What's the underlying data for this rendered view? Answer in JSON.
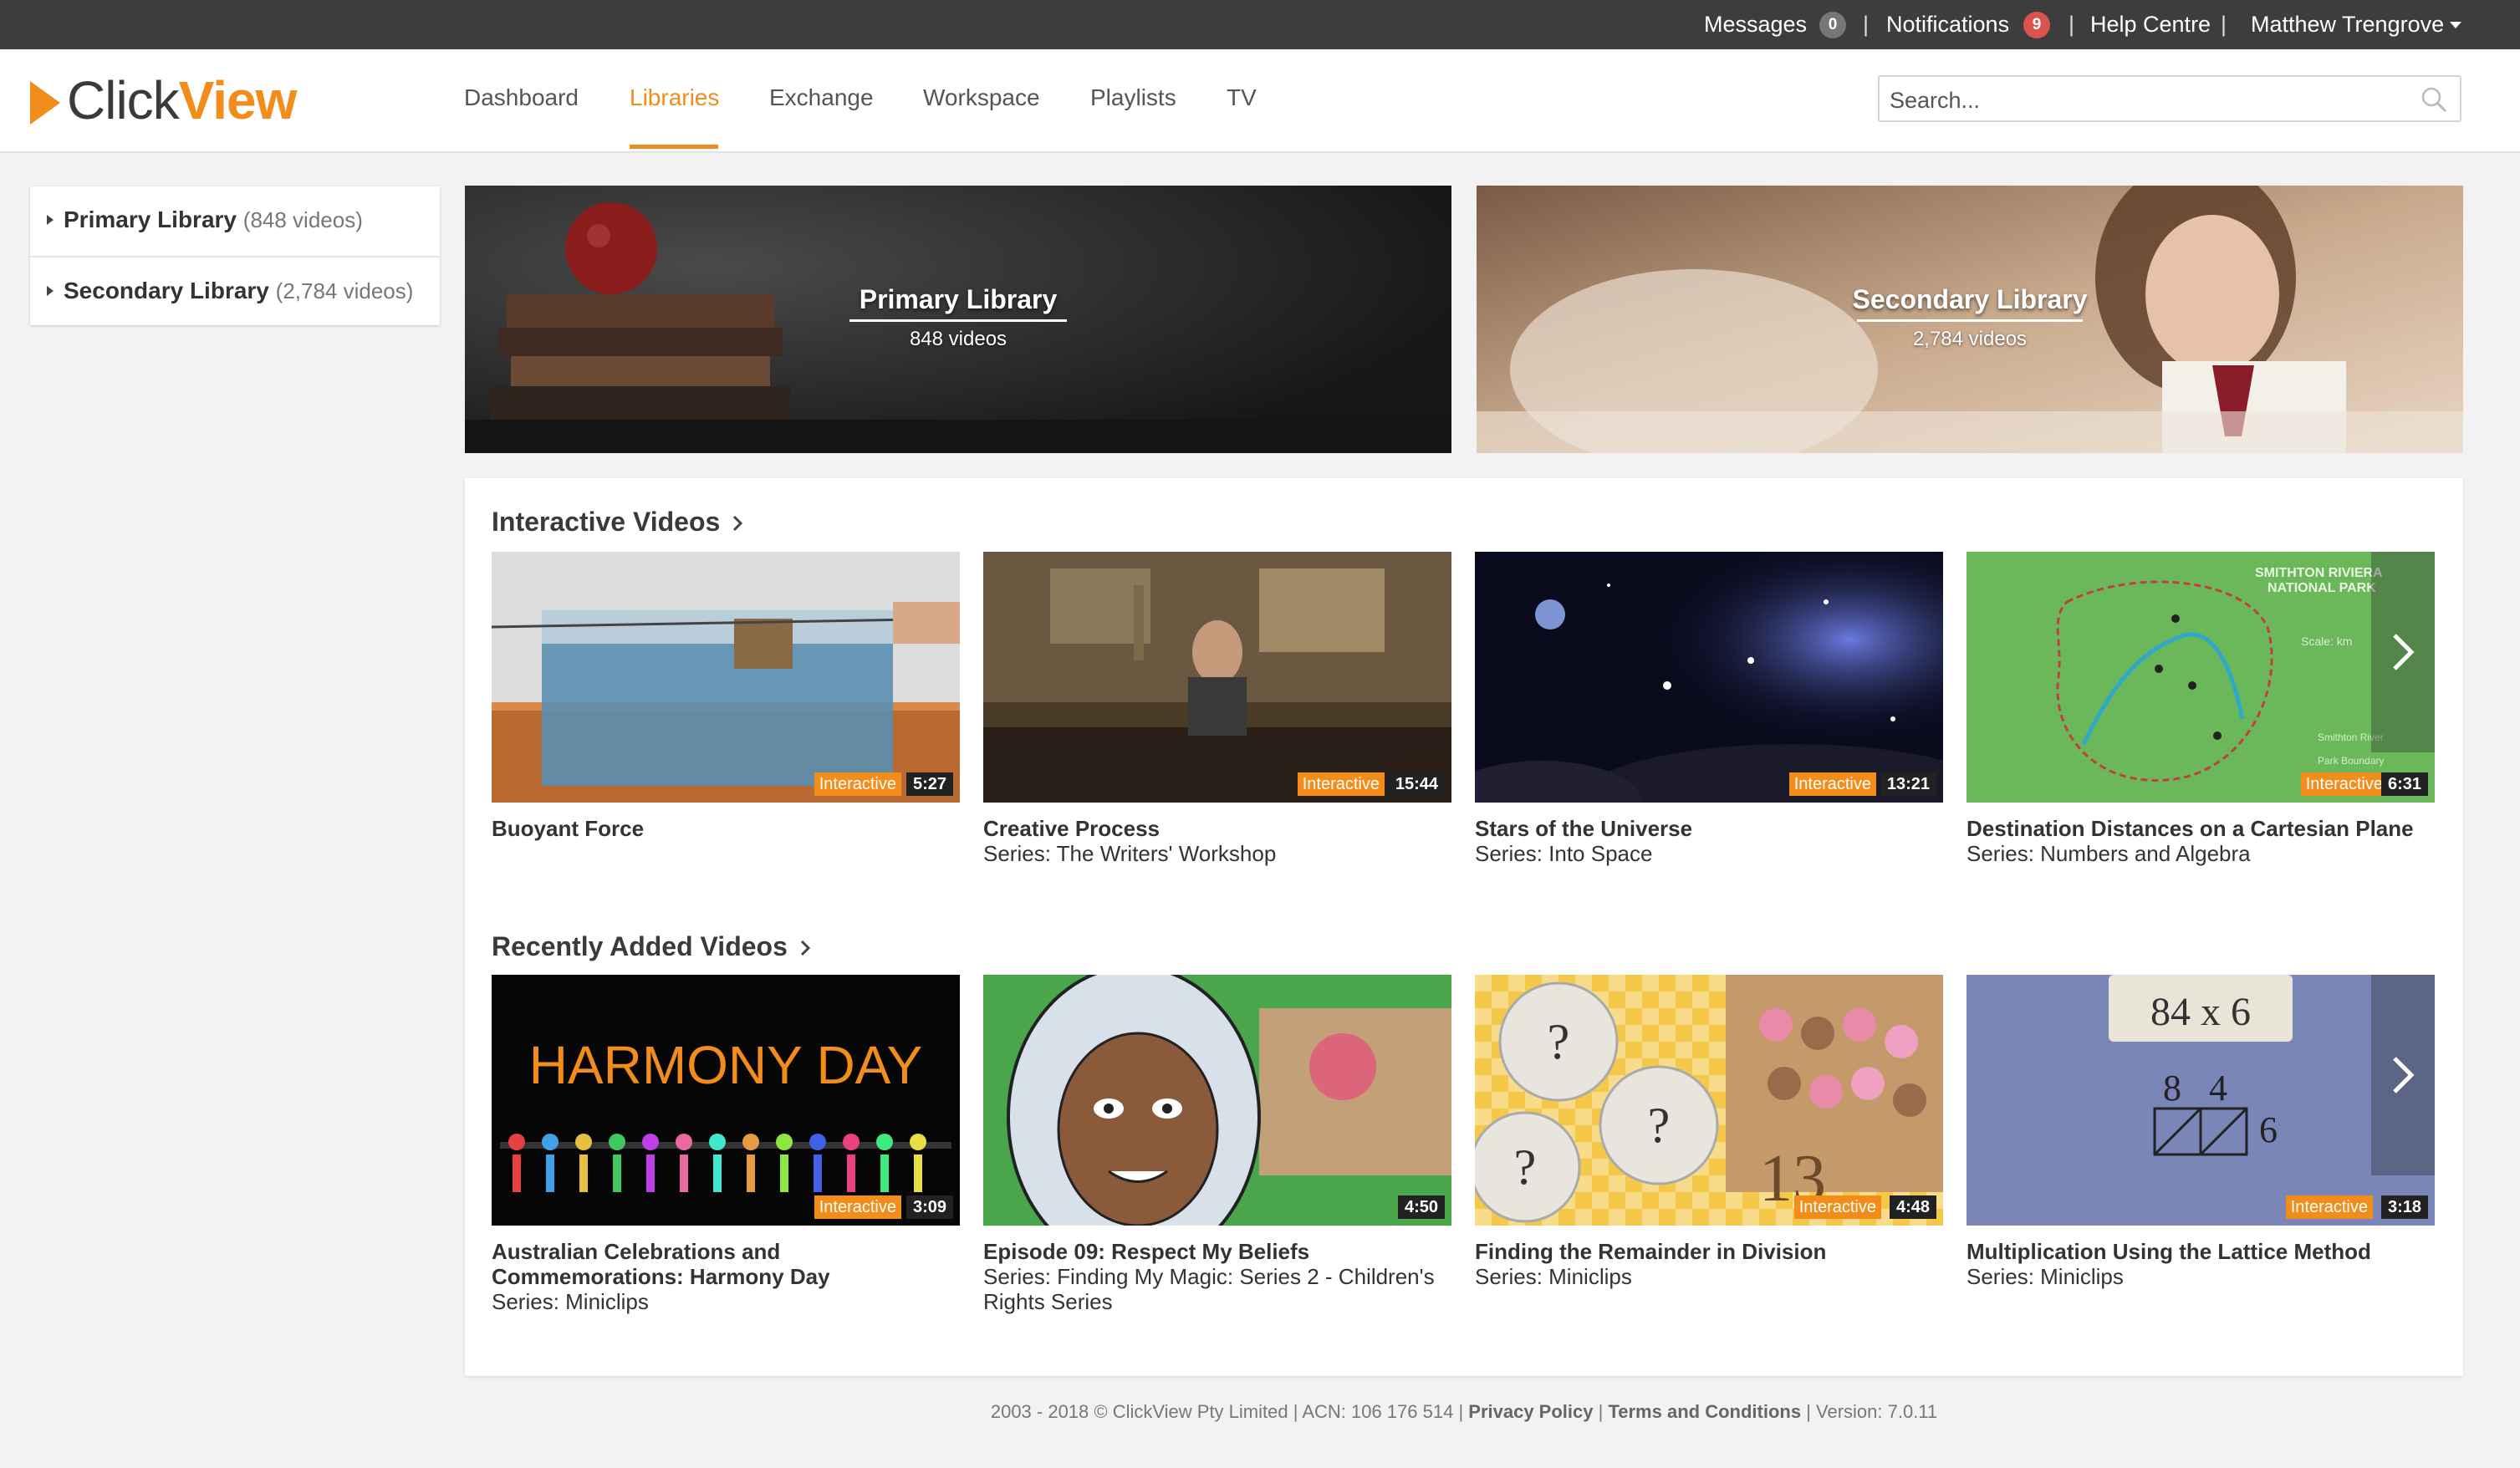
{
  "topbar": {
    "messages_label": "Messages",
    "messages_count": "0",
    "notifications_label": "Notifications",
    "notifications_count": "9",
    "help_label": "Help Centre",
    "user_name": "Matthew Trengrove",
    "separator": "|"
  },
  "header": {
    "logo_part1": "Click",
    "logo_part2": "View",
    "nav": [
      "Dashboard",
      "Libraries",
      "Exchange",
      "Workspace",
      "Playlists",
      "TV"
    ],
    "active_nav": "Libraries",
    "search_placeholder": "Search..."
  },
  "sidebar": {
    "items": [
      {
        "label": "Primary Library",
        "count": "(848 videos)"
      },
      {
        "label": "Secondary Library",
        "count": "(2,784 videos)"
      }
    ]
  },
  "banners": [
    {
      "title": "Primary Library",
      "subtitle": "848 videos"
    },
    {
      "title": "Secondary Library",
      "subtitle": "2,784 videos"
    }
  ],
  "sections": {
    "interactive": {
      "title": "Interactive Videos",
      "videos": [
        {
          "title": "Buoyant Force",
          "series": "",
          "tag": "Interactive",
          "duration": "5:27"
        },
        {
          "title": "Creative Process",
          "series": "Series: The Writers' Workshop",
          "tag": "Interactive",
          "duration": "15:44"
        },
        {
          "title": "Stars of the Universe",
          "series": "Series: Into Space",
          "tag": "Interactive",
          "duration": "13:21"
        },
        {
          "title": "Destination Distances on a Cartesian Plane",
          "series": "Series: Numbers and Algebra",
          "tag": "Interactive",
          "duration": "6:31"
        }
      ]
    },
    "recent": {
      "title": "Recently Added Videos",
      "videos": [
        {
          "title": "Australian Celebrations and Commemorations: Harmony Day",
          "series": "Series: Miniclips",
          "tag": "Interactive",
          "duration": "3:09"
        },
        {
          "title": "Episode 09: Respect My Beliefs",
          "series": "Series: Finding My Magic: Series 2 - Children's Rights Series",
          "tag": "",
          "duration": "4:50"
        },
        {
          "title": "Finding the Remainder in Division",
          "series": "Series: Miniclips",
          "tag": "Interactive",
          "duration": "4:48"
        },
        {
          "title": "Multiplication Using the Lattice Method",
          "series": "Series: Miniclips",
          "tag": "Interactive",
          "duration": "3:18"
        }
      ]
    }
  },
  "thumb_text": {
    "park_title_1": "SMITHTON RIVIERA",
    "park_title_2": "NATIONAL PARK",
    "scale": "Scale: km",
    "legend_1": "Smithton River",
    "legend_2": "Park Boundary",
    "harmony": "HARMONY DAY",
    "division_number": "13",
    "lattice_eq": "84 x 6",
    "lattice_a": "8",
    "lattice_b": "4",
    "lattice_c": "6"
  },
  "footer": {
    "copyright": "2003 - 2018 © ClickView Pty Limited | ACN: 106 176 514 | ",
    "privacy": "Privacy Policy",
    "sep": " | ",
    "terms": "Terms and Conditions",
    "version": " | Version: 7.0.11"
  },
  "colors": {
    "accent": "#f28c1b",
    "topbar": "#3d3d3d",
    "notification_badge": "#d9534f",
    "message_badge": "#777777"
  }
}
